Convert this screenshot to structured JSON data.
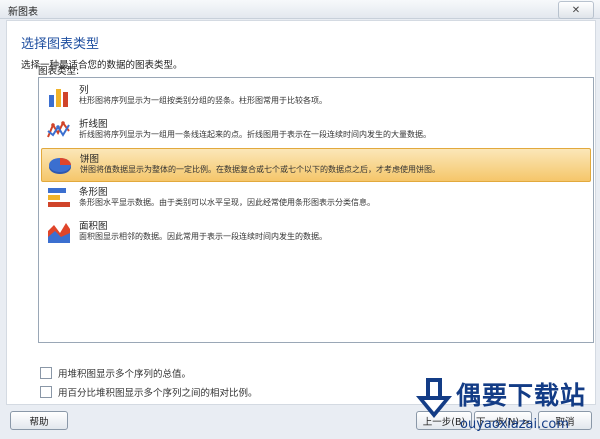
{
  "window": {
    "title": "新图表",
    "close_label": "✕"
  },
  "dialog": {
    "heading": "选择图表类型",
    "instruction": "选择一种最适合您的数据的图表类型。",
    "group_label": "图表类型:",
    "chart_types": [
      {
        "name": "列",
        "desc": "柱形图将序列显示为一组按类别分组的竖条。柱形图常用于比较各项。",
        "icon": "column-chart-icon"
      },
      {
        "name": "折线图",
        "desc": "折线图将序列显示为一组用一条线连起来的点。折线图用于表示在一段连续时间内发生的大量数据。",
        "icon": "line-chart-icon"
      },
      {
        "name": "饼图",
        "desc": "饼图将值数据显示为整体的一定比例。在数据复合或七个或七个以下的数据点之后，才考虑使用饼图。",
        "icon": "pie-chart-icon",
        "selected": true
      },
      {
        "name": "条形图",
        "desc": "条形图水平显示数据。由于类别可以水平呈现，因此经常使用条形图表示分类信息。",
        "icon": "bar-chart-icon"
      },
      {
        "name": "面积图",
        "desc": "面积图显示相邻的数据。因此常用于表示一段连续时间内发生的数据。",
        "icon": "area-chart-icon"
      }
    ],
    "options": {
      "stacked": "用堆积图显示多个序列的总值。",
      "percent_stacked": "用百分比堆积图显示多个序列之间的相对比例。"
    }
  },
  "buttons": {
    "help": "帮助",
    "back": "上一步(B)",
    "next": "下一步(N) >",
    "cancel": "取消"
  },
  "watermark": {
    "brand": "偶要下载站",
    "url": "ouyaoxiazai.com"
  },
  "colors": {
    "heading": "#1f4fa0",
    "selection": "#f5c66a",
    "watermark": "#133c86"
  }
}
